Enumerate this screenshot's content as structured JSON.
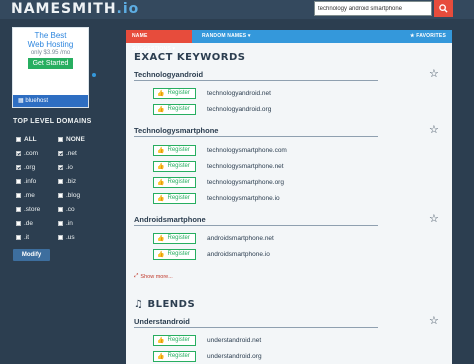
{
  "header": {
    "logo_main": "NAMESMITH",
    "logo_tld": ".io",
    "search_value": "technology android smartphone"
  },
  "ad": {
    "title_line1": "The Best",
    "title_line2": "Web Hosting",
    "price": "only $3.95 /mo",
    "cta": "Get Started",
    "brand": "bluehost"
  },
  "sidebar": {
    "tld_title": "TOP LEVEL DOMAINS",
    "all_label": "ALL",
    "none_label": "NONE",
    "tlds": [
      {
        "label": ".com",
        "checked": true
      },
      {
        "label": ".net",
        "checked": true
      },
      {
        "label": ".org",
        "checked": true
      },
      {
        "label": ".io",
        "checked": true
      },
      {
        "label": ".info",
        "checked": false
      },
      {
        "label": ".biz",
        "checked": false
      },
      {
        "label": ".me",
        "checked": false
      },
      {
        "label": ".blog",
        "checked": false
      },
      {
        "label": ".store",
        "checked": false
      },
      {
        "label": ".co",
        "checked": false
      },
      {
        "label": ".de",
        "checked": false
      },
      {
        "label": ".in",
        "checked": false
      },
      {
        "label": ".it",
        "checked": false
      },
      {
        "label": ".us",
        "checked": false
      }
    ],
    "modify_label": "Modify"
  },
  "tabs": {
    "name_suggestions": "NAME SUGGESTIONS ▾",
    "random_names": "RANDOM NAMES ▾",
    "favorites": "★ FAVORITES"
  },
  "exact": {
    "title": "EXACT KEYWORDS",
    "register_label": "Register",
    "groups": [
      {
        "name": "Technologyandroid",
        "domains": [
          "technologyandroid.net",
          "technologyandroid.org"
        ]
      },
      {
        "name": "Technologysmartphone",
        "domains": [
          "technologysmartphone.com",
          "technologysmartphone.net",
          "technologysmartphone.org",
          "technologysmartphone.io"
        ]
      },
      {
        "name": "Androidsmartphone",
        "domains": [
          "androidsmartphone.net",
          "androidsmartphone.io"
        ]
      }
    ],
    "show_more": "Show more..."
  },
  "blends": {
    "title": "BLENDS",
    "groups": [
      {
        "name": "Understandroid",
        "domains": [
          "understandroid.net",
          "understandroid.org"
        ]
      }
    ]
  },
  "colors": {
    "header_bg": "#34495e",
    "accent_blue": "#3498db",
    "accent_red": "#e74c3c",
    "register_green": "#27ae60"
  }
}
